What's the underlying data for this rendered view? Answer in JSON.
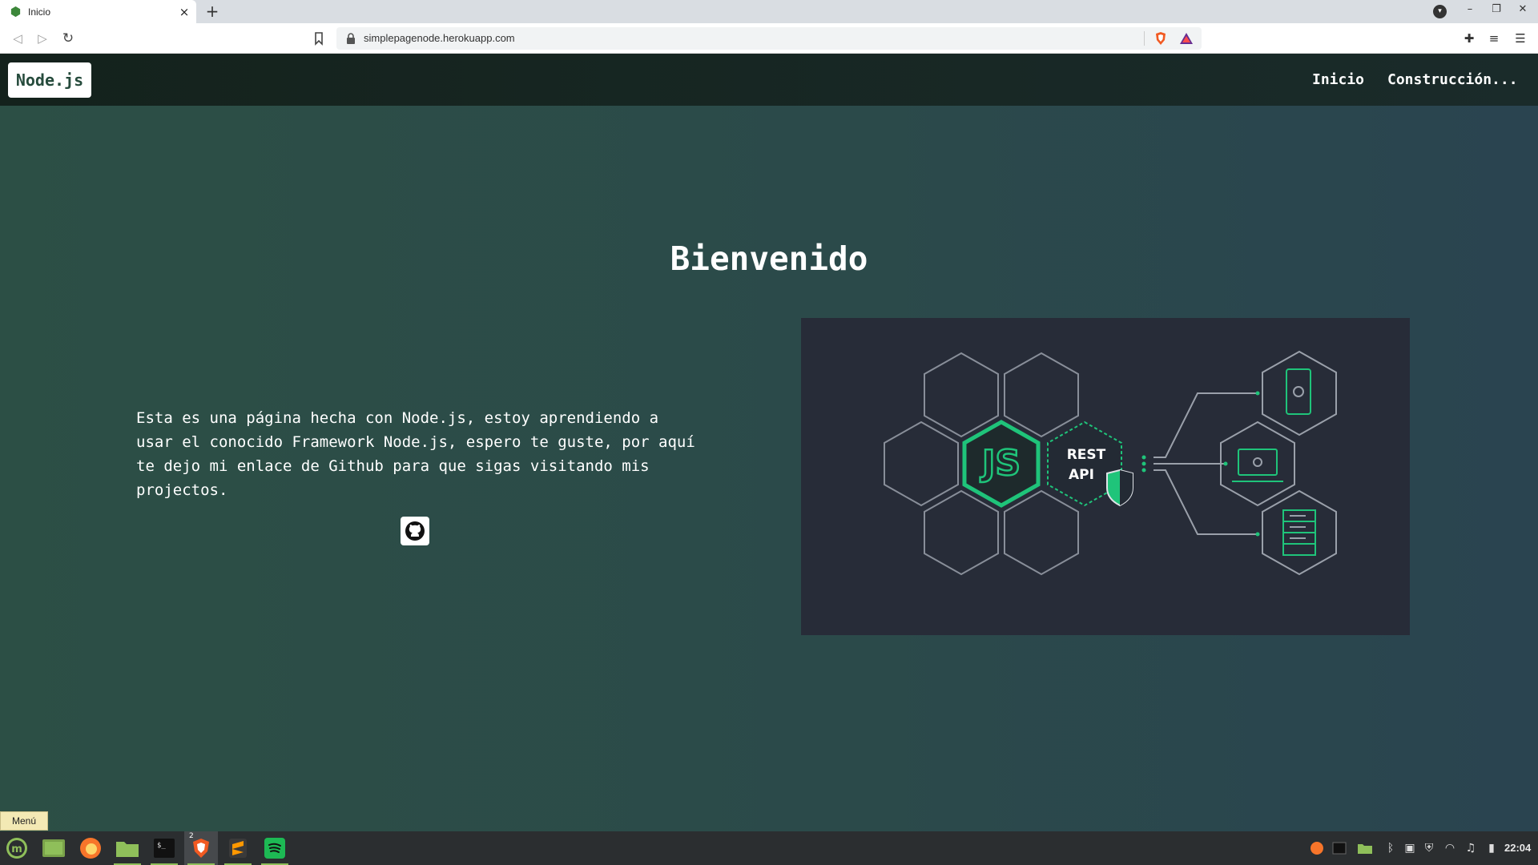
{
  "browser": {
    "tab_title": "Inicio",
    "tab_close": "×",
    "new_tab": "+",
    "url": "simplepagenode.herokuapp.com"
  },
  "site": {
    "brand": "Node.js",
    "nav": [
      {
        "label": "Inicio"
      },
      {
        "label": "Construcción..."
      }
    ],
    "title": "Bienvenido",
    "intro": "Esta es una página hecha con Node.js, estoy aprendiendo a usar el conocido Framework Node.js, espero te guste, por aquí te dejo mi enlace de Github para que sigas visitando mis projectos.",
    "hero_image": {
      "badge_js": "JS",
      "badge_rest": "REST",
      "badge_api": "API"
    }
  },
  "taskbar": {
    "menu_tooltip": "Menú",
    "clock": "22:04",
    "brave_badge": "2"
  },
  "colors": {
    "node_green": "#1fc47a",
    "nav_bg": "#14221c",
    "page_bg": "#2b4a44",
    "image_bg": "#272c38"
  }
}
